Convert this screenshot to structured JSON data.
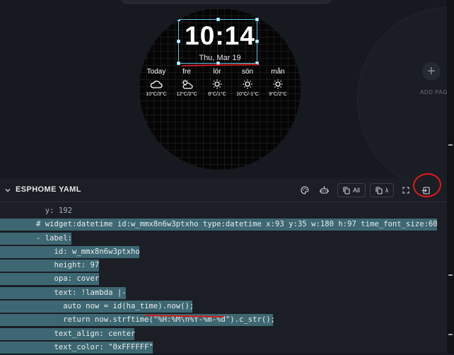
{
  "clock": {
    "time": "10:14",
    "date": "Thu, Mar 19"
  },
  "forecast": [
    {
      "day": "Today",
      "icon": "cloud-icon",
      "temp": "10°C/3°C"
    },
    {
      "day": "fre",
      "icon": "partly-cloudy-icon",
      "temp": "12°C/2°C"
    },
    {
      "day": "lör",
      "icon": "sun-icon",
      "temp": "8°C/1°C"
    },
    {
      "day": "sön",
      "icon": "sun-icon",
      "temp": "10°C/-1°C"
    },
    {
      "day": "mån",
      "icon": "sun-icon",
      "temp": "9°C/2°C"
    }
  ],
  "side_page": {
    "add_label": "ADD PAG",
    "add_symbol": "+"
  },
  "panel": {
    "title": "ESPHOME YAML",
    "buttons": {
      "all_label": "All",
      "lambda_label": "λ"
    }
  },
  "code_lines": [
    {
      "text": "          y: 192"
    },
    {
      "text": "        # widget:datetime id:w_mmx8n6w3ptxho type:datetime x:93 y:35 w:180 h:97 time_font_size:60"
    },
    {
      "text": "        - label:"
    },
    {
      "text": "            id: w_mmx8n6w3ptxho"
    },
    {
      "text": "            height: 97"
    },
    {
      "text": "            opa: cover"
    },
    {
      "text": "            text: !lambda |-"
    },
    {
      "text": "              auto now = id(ha_time).now();"
    },
    {
      "text": "              return now.strftime(\"%H:%M\\n%Y-%m-%d\").c_str();"
    },
    {
      "text": "            text_align: center"
    },
    {
      "text": "            text_color: \"0xFFFFFF\""
    }
  ],
  "colors": {
    "selection": "#5ec6e6",
    "highlight": "#3d6873",
    "annotation_red": "#d01e1e"
  }
}
